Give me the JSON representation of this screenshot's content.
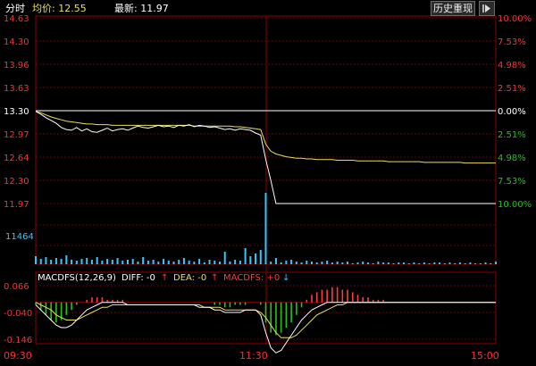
{
  "header": {
    "timeshare_label": "分时",
    "avg_label": "均价: 12.55",
    "latest_label": "最新: 11.97",
    "history_button": "历史重现"
  },
  "colors": {
    "up": "#ff3b3b",
    "down": "#25c21c",
    "price_line": "#ffffff",
    "avg_line": "#e8e060",
    "volume": "#35c8ff",
    "grid": "#7a0000",
    "axis_text": "#ff3030",
    "dea_line": "#e8e060",
    "diff_line": "#ffffff"
  },
  "icons": {
    "nav": "nav-right-icon"
  },
  "price_axis": {
    "left_ticks": [
      "14.63",
      "14.30",
      "13.96",
      "13.63",
      "13.30",
      "12.97",
      "12.64",
      "12.30",
      "11.97"
    ],
    "right_ticks": [
      "10.00%",
      "7.53%",
      "4.98%",
      "2.51%",
      "0.00%",
      "2.51%",
      "4.98%",
      "7.53%",
      "10.00%"
    ],
    "prev_close": 13.3
  },
  "volume_axis": {
    "label": "11464"
  },
  "macd": {
    "title": "MACDFS(12,26,9)",
    "diff_label": "DIFF: -0",
    "dea_label": "DEA: -0",
    "macdfs_label": "MACDFS: +0",
    "ticks": [
      "0.066",
      "-0.040",
      "-0.146"
    ]
  },
  "time_axis": {
    "labels": [
      "09:30",
      "11:30",
      "15:00"
    ]
  },
  "chart_data": {
    "type": "line",
    "x_range": [
      "09:30",
      "15:00"
    ],
    "ylim": [
      11.97,
      14.63
    ],
    "series": [
      {
        "role": "price",
        "values": [
          13.29,
          13.25,
          13.2,
          13.16,
          13.12,
          13.06,
          13.03,
          13.02,
          13.06,
          13.01,
          13.04,
          13.0,
          12.99,
          13.02,
          13.05,
          13.01,
          13.03,
          13.04,
          13.02,
          13.05,
          13.08,
          13.06,
          13.05,
          13.07,
          13.09,
          13.07,
          13.08,
          13.06,
          13.09,
          13.08,
          13.1,
          13.07,
          13.09,
          13.08,
          13.06,
          13.07,
          13.05,
          13.03,
          13.04,
          13.02,
          13.04,
          13.03,
          13.02,
          12.98,
          12.95,
          12.6,
          12.3,
          11.97,
          11.97,
          11.97,
          11.97,
          11.97,
          11.97,
          11.97,
          11.97,
          11.97,
          11.97,
          11.97,
          11.97,
          11.97,
          11.97,
          11.97,
          11.97,
          11.97,
          11.97,
          11.97,
          11.97,
          11.97,
          11.97,
          11.97,
          11.97,
          11.97,
          11.97,
          11.97,
          11.97,
          11.97,
          11.97,
          11.97,
          11.97,
          11.97,
          11.97,
          11.97,
          11.97,
          11.97,
          11.97,
          11.97,
          11.97,
          11.97,
          11.97,
          11.97,
          11.97
        ]
      },
      {
        "role": "average",
        "values": [
          13.29,
          13.27,
          13.24,
          13.21,
          13.19,
          13.17,
          13.15,
          13.14,
          13.13,
          13.12,
          13.11,
          13.11,
          13.1,
          13.1,
          13.1,
          13.09,
          13.09,
          13.09,
          13.09,
          13.09,
          13.09,
          13.09,
          13.09,
          13.09,
          13.09,
          13.09,
          13.09,
          13.09,
          13.09,
          13.09,
          13.09,
          13.08,
          13.08,
          13.08,
          13.08,
          13.08,
          13.08,
          13.08,
          13.08,
          13.07,
          13.07,
          13.06,
          13.05,
          13.04,
          13.03,
          12.82,
          12.72,
          12.68,
          12.66,
          12.64,
          12.63,
          12.62,
          12.62,
          12.61,
          12.61,
          12.6,
          12.6,
          12.6,
          12.6,
          12.59,
          12.59,
          12.59,
          12.59,
          12.58,
          12.58,
          12.58,
          12.58,
          12.58,
          12.58,
          12.57,
          12.57,
          12.57,
          12.57,
          12.57,
          12.57,
          12.57,
          12.56,
          12.56,
          12.56,
          12.56,
          12.56,
          12.56,
          12.56,
          12.56,
          12.55,
          12.55,
          12.55,
          12.55,
          12.55,
          12.55,
          12.55
        ]
      }
    ],
    "volume": [
      9,
      6,
      8,
      5,
      7,
      6,
      10,
      5,
      4,
      6,
      7,
      5,
      8,
      4,
      6,
      5,
      7,
      4,
      5,
      6,
      3,
      8,
      4,
      5,
      3,
      6,
      4,
      3,
      5,
      7,
      4,
      3,
      6,
      2,
      5,
      4,
      3,
      14,
      3,
      5,
      4,
      18,
      9,
      12,
      16,
      80,
      3,
      7,
      2,
      4,
      5,
      3,
      2,
      4,
      3,
      2,
      3,
      4,
      2,
      3,
      2,
      3,
      1,
      2,
      3,
      2,
      1,
      3,
      2,
      2,
      1,
      2,
      2,
      1,
      2,
      1,
      2,
      1,
      2,
      2,
      1,
      2,
      1,
      2,
      1,
      2,
      1,
      1,
      2,
      1,
      3
    ],
    "macd_hist": [
      -0.01,
      -0.03,
      -0.05,
      -0.07,
      -0.08,
      -0.07,
      -0.05,
      -0.03,
      -0.01,
      0.0,
      0.01,
      0.02,
      0.02,
      0.02,
      0.01,
      0.01,
      0.01,
      0.01,
      0.0,
      0.0,
      0.0,
      0.0,
      0.0,
      0.0,
      0.0,
      0.0,
      0.0,
      0.0,
      0.0,
      0.0,
      0.0,
      0.0,
      0.0,
      0.0,
      0.0,
      -0.01,
      -0.01,
      -0.02,
      -0.02,
      -0.01,
      -0.01,
      -0.01,
      0.0,
      0.0,
      -0.01,
      -0.08,
      -0.12,
      -0.13,
      -0.12,
      -0.1,
      -0.08,
      -0.05,
      -0.02,
      0.01,
      0.03,
      0.04,
      0.05,
      0.05,
      0.06,
      0.06,
      0.05,
      0.05,
      0.04,
      0.03,
      0.02,
      0.02,
      0.01,
      0.01,
      0.01,
      0.0,
      0.0,
      0.0,
      0.0,
      0.0,
      0.0,
      0.0,
      0.0,
      0.0,
      0.0,
      0.0,
      0.0,
      0.0,
      0.0,
      0.0,
      0.0,
      0.0,
      0.0,
      0.0,
      0.0,
      0.0,
      0.0
    ],
    "diff": [
      -0.01,
      -0.03,
      -0.05,
      -0.07,
      -0.09,
      -0.1,
      -0.1,
      -0.09,
      -0.07,
      -0.05,
      -0.03,
      -0.02,
      -0.01,
      0.0,
      0.0,
      0.0,
      0.0,
      0.0,
      -0.01,
      -0.01,
      -0.01,
      -0.01,
      -0.01,
      -0.01,
      -0.01,
      -0.01,
      -0.01,
      -0.01,
      -0.01,
      -0.01,
      -0.01,
      -0.01,
      -0.02,
      -0.02,
      -0.02,
      -0.03,
      -0.03,
      -0.04,
      -0.04,
      -0.04,
      -0.04,
      -0.03,
      -0.03,
      -0.03,
      -0.05,
      -0.12,
      -0.18,
      -0.2,
      -0.19,
      -0.16,
      -0.13,
      -0.1,
      -0.07,
      -0.05,
      -0.03,
      -0.02,
      -0.01,
      0.0,
      0.0,
      0.0,
      0.0,
      0.0,
      0.0,
      0.0,
      0.0,
      0.0,
      0.0,
      0.0,
      0.0,
      0.0,
      0.0,
      0.0,
      0.0,
      0.0,
      0.0,
      0.0,
      0.0,
      0.0,
      0.0,
      0.0,
      0.0,
      0.0,
      0.0,
      0.0,
      0.0,
      0.0,
      0.0,
      0.0,
      0.0,
      0.0,
      0.0
    ],
    "dea": [
      0.0,
      -0.01,
      -0.02,
      -0.03,
      -0.05,
      -0.06,
      -0.07,
      -0.07,
      -0.07,
      -0.06,
      -0.05,
      -0.04,
      -0.03,
      -0.02,
      -0.02,
      -0.01,
      -0.01,
      -0.01,
      -0.01,
      -0.01,
      -0.01,
      -0.01,
      -0.01,
      -0.01,
      -0.01,
      -0.01,
      -0.01,
      -0.01,
      -0.01,
      -0.01,
      -0.01,
      -0.01,
      -0.01,
      -0.02,
      -0.02,
      -0.02,
      -0.02,
      -0.03,
      -0.03,
      -0.03,
      -0.03,
      -0.03,
      -0.03,
      -0.03,
      -0.04,
      -0.06,
      -0.09,
      -0.12,
      -0.14,
      -0.14,
      -0.14,
      -0.13,
      -0.11,
      -0.09,
      -0.07,
      -0.05,
      -0.04,
      -0.03,
      -0.02,
      -0.01,
      -0.01,
      0.0,
      0.0,
      0.0,
      0.0,
      0.0,
      0.0,
      0.0,
      0.0,
      0.0,
      0.0,
      0.0,
      0.0,
      0.0,
      0.0,
      0.0,
      0.0,
      0.0,
      0.0,
      0.0,
      0.0,
      0.0,
      0.0,
      0.0,
      0.0,
      0.0,
      0.0,
      0.0,
      0.0,
      0.0,
      0.0
    ],
    "macd_ylim": [
      -0.146,
      0.066
    ]
  }
}
